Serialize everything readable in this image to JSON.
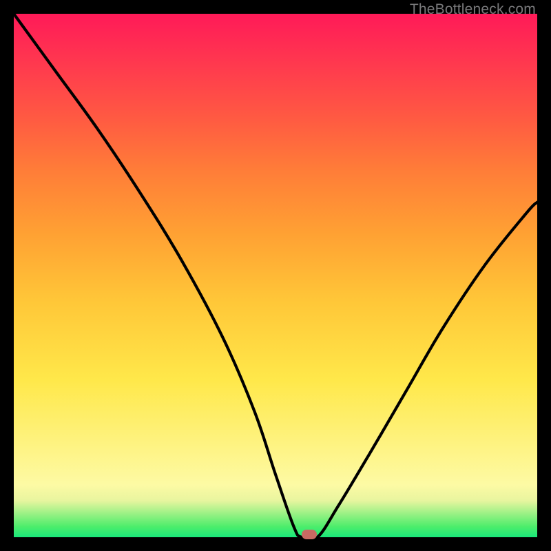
{
  "watermark": "TheBottleneck.com",
  "chart_data": {
    "type": "line",
    "title": "",
    "xlabel": "",
    "ylabel": "",
    "xlim": [
      0,
      100
    ],
    "ylim": [
      0,
      100
    ],
    "series": [
      {
        "name": "curve",
        "x": [
          0,
          8,
          16,
          24,
          32,
          40,
          46,
          50,
          53.5,
          55,
          58,
          62,
          68,
          75,
          82,
          90,
          98,
          100
        ],
        "values": [
          100,
          89,
          78,
          66,
          53,
          38,
          24,
          12,
          2,
          0,
          0,
          6,
          16,
          28,
          40,
          52,
          62,
          64
        ]
      }
    ],
    "marker": {
      "x": 56.5,
      "y": 0.5
    },
    "gradient_stops": [
      {
        "pos": 0,
        "color": "#19e87b"
      },
      {
        "pos": 2,
        "color": "#4ced6b"
      },
      {
        "pos": 7,
        "color": "#e8f59f"
      },
      {
        "pos": 10,
        "color": "#fdfaa4"
      },
      {
        "pos": 30,
        "color": "#ffe84a"
      },
      {
        "pos": 45,
        "color": "#ffc738"
      },
      {
        "pos": 58,
        "color": "#ffa133"
      },
      {
        "pos": 70,
        "color": "#ff7d38"
      },
      {
        "pos": 80,
        "color": "#ff5a42"
      },
      {
        "pos": 90,
        "color": "#ff3a4e"
      },
      {
        "pos": 100,
        "color": "#ff1a58"
      }
    ]
  }
}
